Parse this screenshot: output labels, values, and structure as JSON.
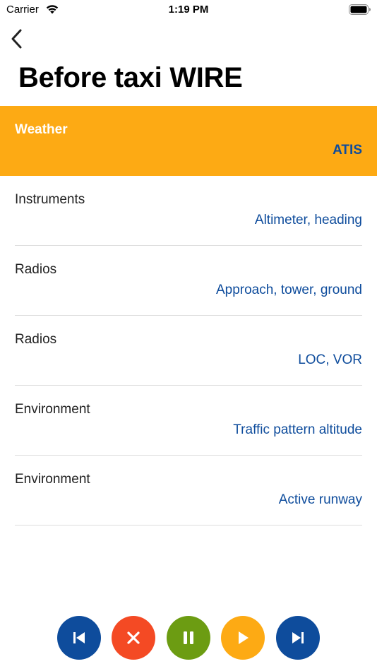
{
  "status_bar": {
    "carrier": "Carrier",
    "time": "1:19 PM"
  },
  "page": {
    "title": "Before taxi WIRE"
  },
  "items": [
    {
      "category": "Weather",
      "value": "ATIS",
      "highlighted": true
    },
    {
      "category": "Instruments",
      "value": "Altimeter, heading",
      "highlighted": false
    },
    {
      "category": "Radios",
      "value": "Approach, tower, ground",
      "highlighted": false
    },
    {
      "category": "Radios",
      "value": "LOC, VOR",
      "highlighted": false
    },
    {
      "category": "Environment",
      "value": "Traffic pattern altitude",
      "highlighted": false
    },
    {
      "category": "Environment",
      "value": "Active runway",
      "highlighted": false
    }
  ],
  "controls": {
    "icons": [
      "skip-previous-icon",
      "stop-icon",
      "pause-icon",
      "play-icon",
      "skip-next-icon"
    ]
  },
  "colors": {
    "accent_orange": "#fdaa14",
    "accent_blue": "#0e4c9c",
    "stop_red": "#f44a24",
    "pause_green": "#6c9c12"
  }
}
